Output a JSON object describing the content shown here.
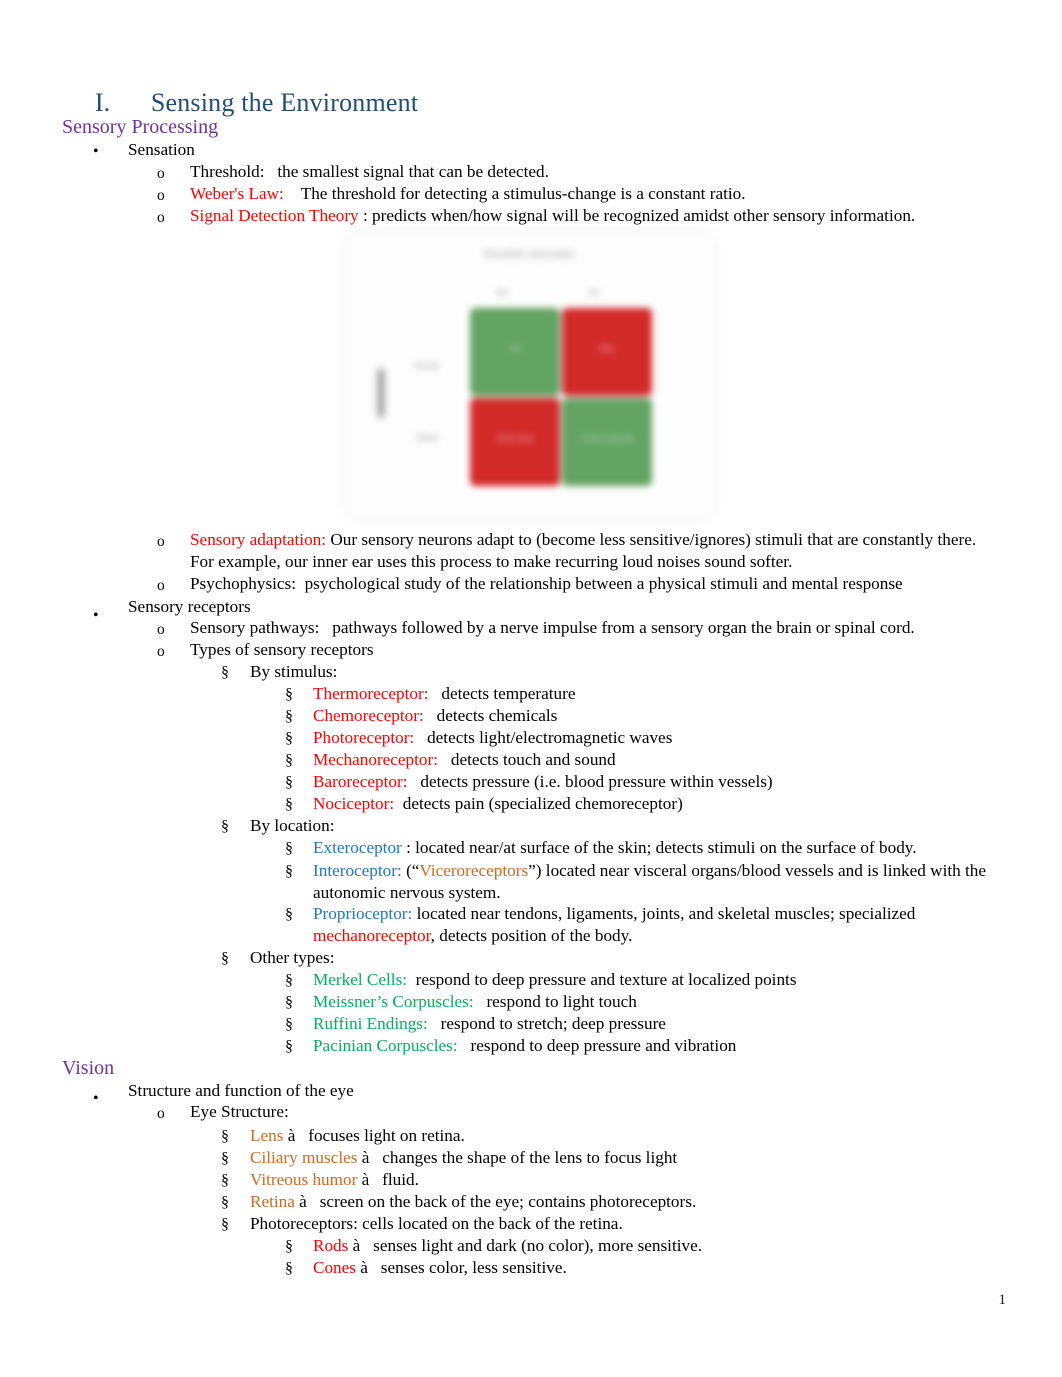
{
  "document": {
    "title_numeral": "I.",
    "title_text": "Sensing the Environment",
    "page_number": "1"
  },
  "colors": {
    "title": "#1F4E79",
    "section_heading": "#7030A0",
    "red": "#FF0000",
    "blue": "#2076C4",
    "green": "#00B060",
    "orange": "#D2691E",
    "black": "#000000"
  },
  "markers": {
    "bullet": "•",
    "circle": "o",
    "section": "§",
    "arrow": "à"
  },
  "sections": [
    {
      "heading": "Sensory Processing",
      "heading_color": "#7030A0"
    },
    {
      "heading": "Vision",
      "heading_color": "#7030A0"
    }
  ],
  "content": {
    "sensation_label": "Sensation",
    "threshold_term": "Threshold:",
    "threshold_def": "   the smallest signal that can be detected.",
    "webers_term": "Weber's Law:",
    "webers_def": "    The threshold for detecting a stimulus-change is a constant ratio.",
    "sdt_term": "Signal Detection Theory",
    "sdt_def": " : predicts when/how signal will be recognized amidst other sensory information.",
    "sensory_adaptation_term": "Sensory adaptation:",
    "sensory_adaptation_def": "    Our sensory neurons adapt to (become less sensitive/ignores) stimuli that are constantly there. For example, our inner ear uses this process to make recurring loud noises sound softer.",
    "psychophysics": "Psychophysics:  psychological study of the relationship between a physical stimuli and mental response",
    "sensory_receptors_label": "Sensory receptors",
    "sensory_pathways": "Sensory pathways:   pathways followed by a nerve impulse from a sensory organ the brain or spinal cord.",
    "types_of_receptors": "Types of sensory receptors",
    "by_stimulus_label": "By stimulus:",
    "by_location_label": "By location:",
    "other_types_label": "Other types:",
    "structure_function_eye": "Structure and function of the eye",
    "eye_structure_label": "Eye Structure:",
    "photoreceptors_line": "Photoreceptors: cells located on the back of the retina."
  },
  "by_stimulus": [
    {
      "term": "Thermoreceptor:",
      "def": "   detects temperature",
      "color": "#FF0000"
    },
    {
      "term": "Chemoreceptor:",
      "def": "   detects chemicals",
      "color": "#FF0000"
    },
    {
      "term": "Photoreceptor:",
      "def": "   detects light/electromagnetic waves",
      "color": "#FF0000"
    },
    {
      "term": "Mechanoreceptor:",
      "def": "   detects touch and sound",
      "color": "#FF0000"
    },
    {
      "term": "Baroreceptor:",
      "def": "   detects pressure (i.e. blood pressure within vessels)",
      "color": "#FF0000"
    },
    {
      "term": "Nociceptor:",
      "def": "  detects pain (specialized chemoreceptor)",
      "color": "#FF0000"
    }
  ],
  "by_location": {
    "exteroceptor_term": "Exteroceptor",
    "exteroceptor_def": " : located near/at surface of the skin; detects stimuli on the surface of body.",
    "interoceptor_term": "Interoceptor:",
    "interoceptor_pre": "   (“",
    "interoceptor_inner": "Viceroreceptors",
    "interoceptor_post": "”) located near visceral organs/blood vessels and is linked with the autonomic nervous system.",
    "proprioceptor_term": "Proprioceptor:",
    "proprioceptor_def_a": "    located near tendons, ligaments, joints, and skeletal muscles; specialized ",
    "proprioceptor_highlight": "mechanoreceptor",
    "proprioceptor_def_b": ", detects position of the body."
  },
  "other_types": [
    {
      "term": "Merkel Cells:",
      "def": "  respond to deep pressure and texture at localized points",
      "color": "#00B060"
    },
    {
      "term": "Meissner’s Corpuscles:",
      "def": "   respond to light touch",
      "color": "#00B060"
    },
    {
      "term": "Ruffini Endings:",
      "def": "   respond to stretch; deep pressure",
      "color": "#00B060"
    },
    {
      "term": "Pacinian Corpuscles:",
      "def": "   respond to deep pressure and vibration",
      "color": "#00B060"
    }
  ],
  "eye_structure": [
    {
      "term": "Lens",
      "def": " à   focuses light on retina.",
      "color": "#D2691E"
    },
    {
      "term": "Ciliary muscles",
      "def": " à   changes the shape of the lens to focus light",
      "color": "#D2691E"
    },
    {
      "term": "Vitreous humor",
      "def": " à   fluid.",
      "color": "#D2691E"
    },
    {
      "term": "Retina",
      "def": " à   screen on the back of the eye; contains photoreceptors.",
      "color": "#D2691E"
    }
  ],
  "photoreceptor_types": [
    {
      "term": "Rods",
      "def": " à   senses light and dark (no color), more sensitive.",
      "color": "#FF0000"
    },
    {
      "term": "Cones",
      "def": " à   senses color, less sensitive.",
      "color": "#FF0000"
    }
  ],
  "figure": {
    "name": "signal-detection-theory-matrix",
    "title": "Possible outcomes",
    "column_headers": [
      "Yes",
      "No"
    ],
    "row_headers": [
      "Present",
      "Absent"
    ],
    "quadrants": [
      {
        "position": "top-left",
        "label": "Hit",
        "color": "#63A363"
      },
      {
        "position": "top-right",
        "label": "Miss",
        "color": "#D32A2A"
      },
      {
        "position": "bottom-left",
        "label": "False alarm",
        "color": "#D32A2A"
      },
      {
        "position": "bottom-right",
        "label": "Correct rejection",
        "color": "#63A363"
      }
    ]
  }
}
